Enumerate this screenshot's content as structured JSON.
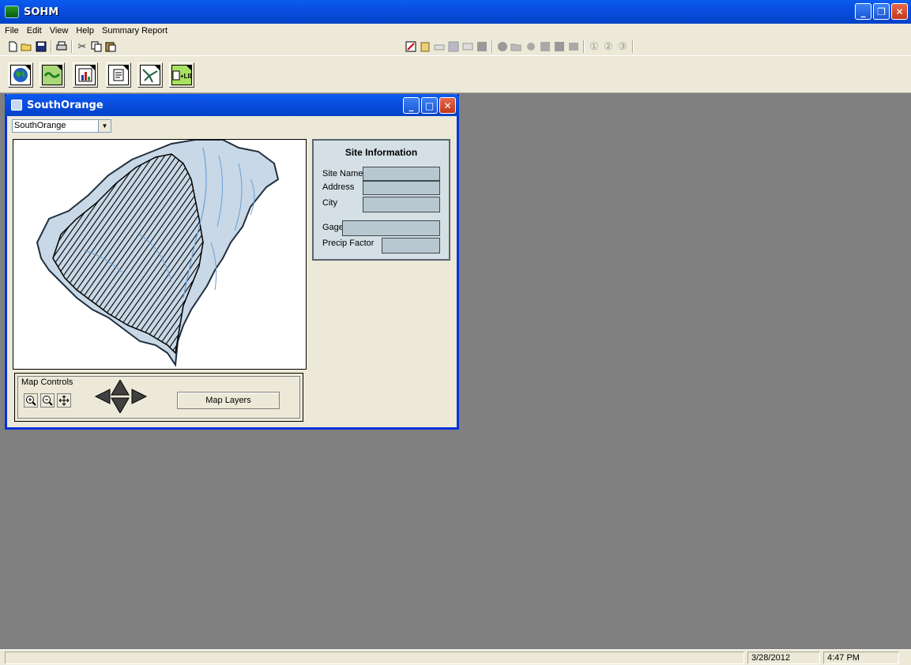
{
  "app": {
    "title": "SOHM"
  },
  "menu": [
    "File",
    "Edit",
    "View",
    "Help",
    "Summary Report"
  ],
  "toolbar_big": [
    "globe-icon",
    "map-icon",
    "chart-icon",
    "report-icon",
    "network-icon",
    "lid-icon"
  ],
  "child": {
    "title": "SouthOrange",
    "dropdown_value": "SouthOrange"
  },
  "site_info": {
    "title": "Site Information",
    "site_name_label": "Site Name",
    "address_label": "Address",
    "city_label": "City",
    "gage_label": "Gage",
    "precip_label": "Precip Factor"
  },
  "map_controls": {
    "label": "Map Controls",
    "layers_button": "Map Layers"
  },
  "status": {
    "date": "3/28/2012",
    "time": "4:47 PM"
  },
  "colors": {
    "titlebar": "#0a5cf0",
    "panel_bg": "#d4e0e6",
    "desktop": "#808080"
  }
}
